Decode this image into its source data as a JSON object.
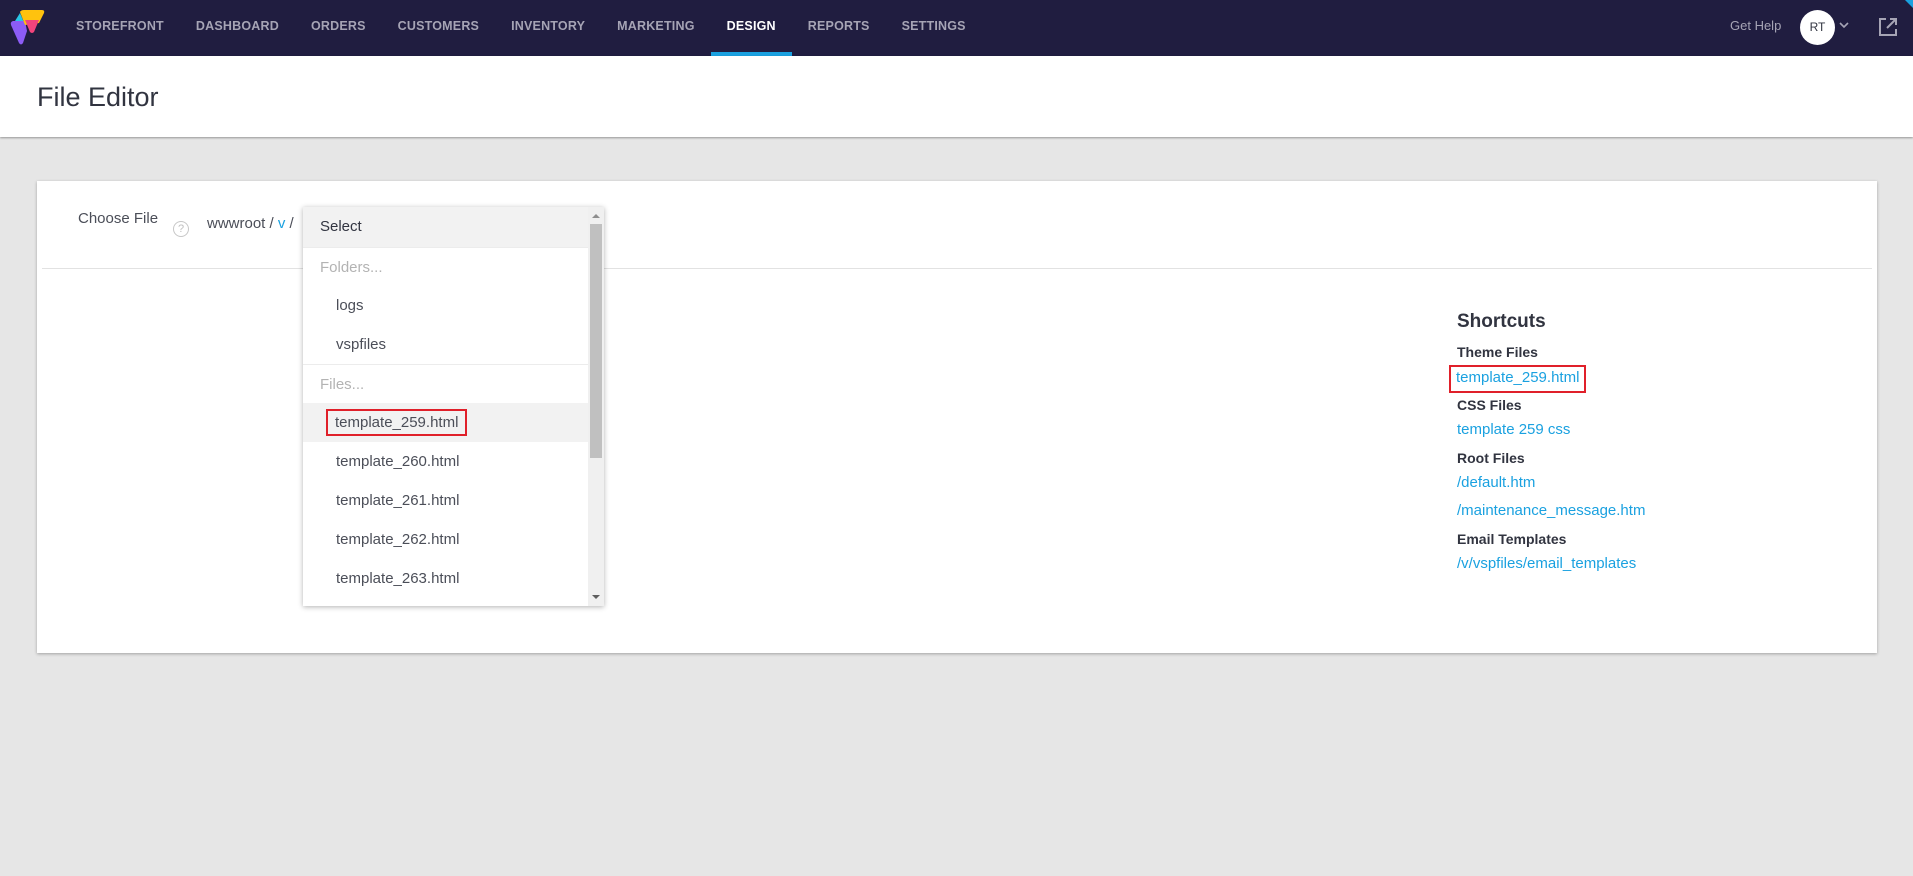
{
  "nav": {
    "items": [
      {
        "label": "STOREFRONT",
        "active": false
      },
      {
        "label": "DASHBOARD",
        "active": false
      },
      {
        "label": "ORDERS",
        "active": false
      },
      {
        "label": "CUSTOMERS",
        "active": false
      },
      {
        "label": "INVENTORY",
        "active": false
      },
      {
        "label": "MARKETING",
        "active": false
      },
      {
        "label": "DESIGN",
        "active": true
      },
      {
        "label": "REPORTS",
        "active": false
      },
      {
        "label": "SETTINGS",
        "active": false
      }
    ],
    "get_help": "Get Help",
    "avatar_initials": "RT",
    "accent_color": "#1aa1e0",
    "background_color": "#201d40"
  },
  "page": {
    "title": "File Editor"
  },
  "file_chooser": {
    "label": "Choose File",
    "help_icon": "?",
    "path": {
      "root": "wwwroot",
      "separator": "/",
      "segments": [
        "v"
      ]
    },
    "dropdown": {
      "placeholder": "Select",
      "folders_label": "Folders...",
      "folders": [
        "logs",
        "vspfiles"
      ],
      "files_label": "Files...",
      "files": [
        "template_259.html",
        "template_260.html",
        "template_261.html",
        "template_262.html",
        "template_263.html"
      ],
      "highlighted_file": "template_259.html"
    }
  },
  "shortcuts": {
    "title": "Shortcuts",
    "groups": [
      {
        "label": "Theme Files",
        "links": [
          "template_259.html"
        ]
      },
      {
        "label": "CSS Files",
        "links": [
          "template 259 css"
        ]
      },
      {
        "label": "Root Files",
        "links": [
          "/default.htm",
          "/maintenance_message.htm"
        ]
      },
      {
        "label": "Email Templates",
        "links": [
          "/v/vspfiles/email_templates"
        ]
      }
    ]
  },
  "annotation_color": "#e0202a"
}
